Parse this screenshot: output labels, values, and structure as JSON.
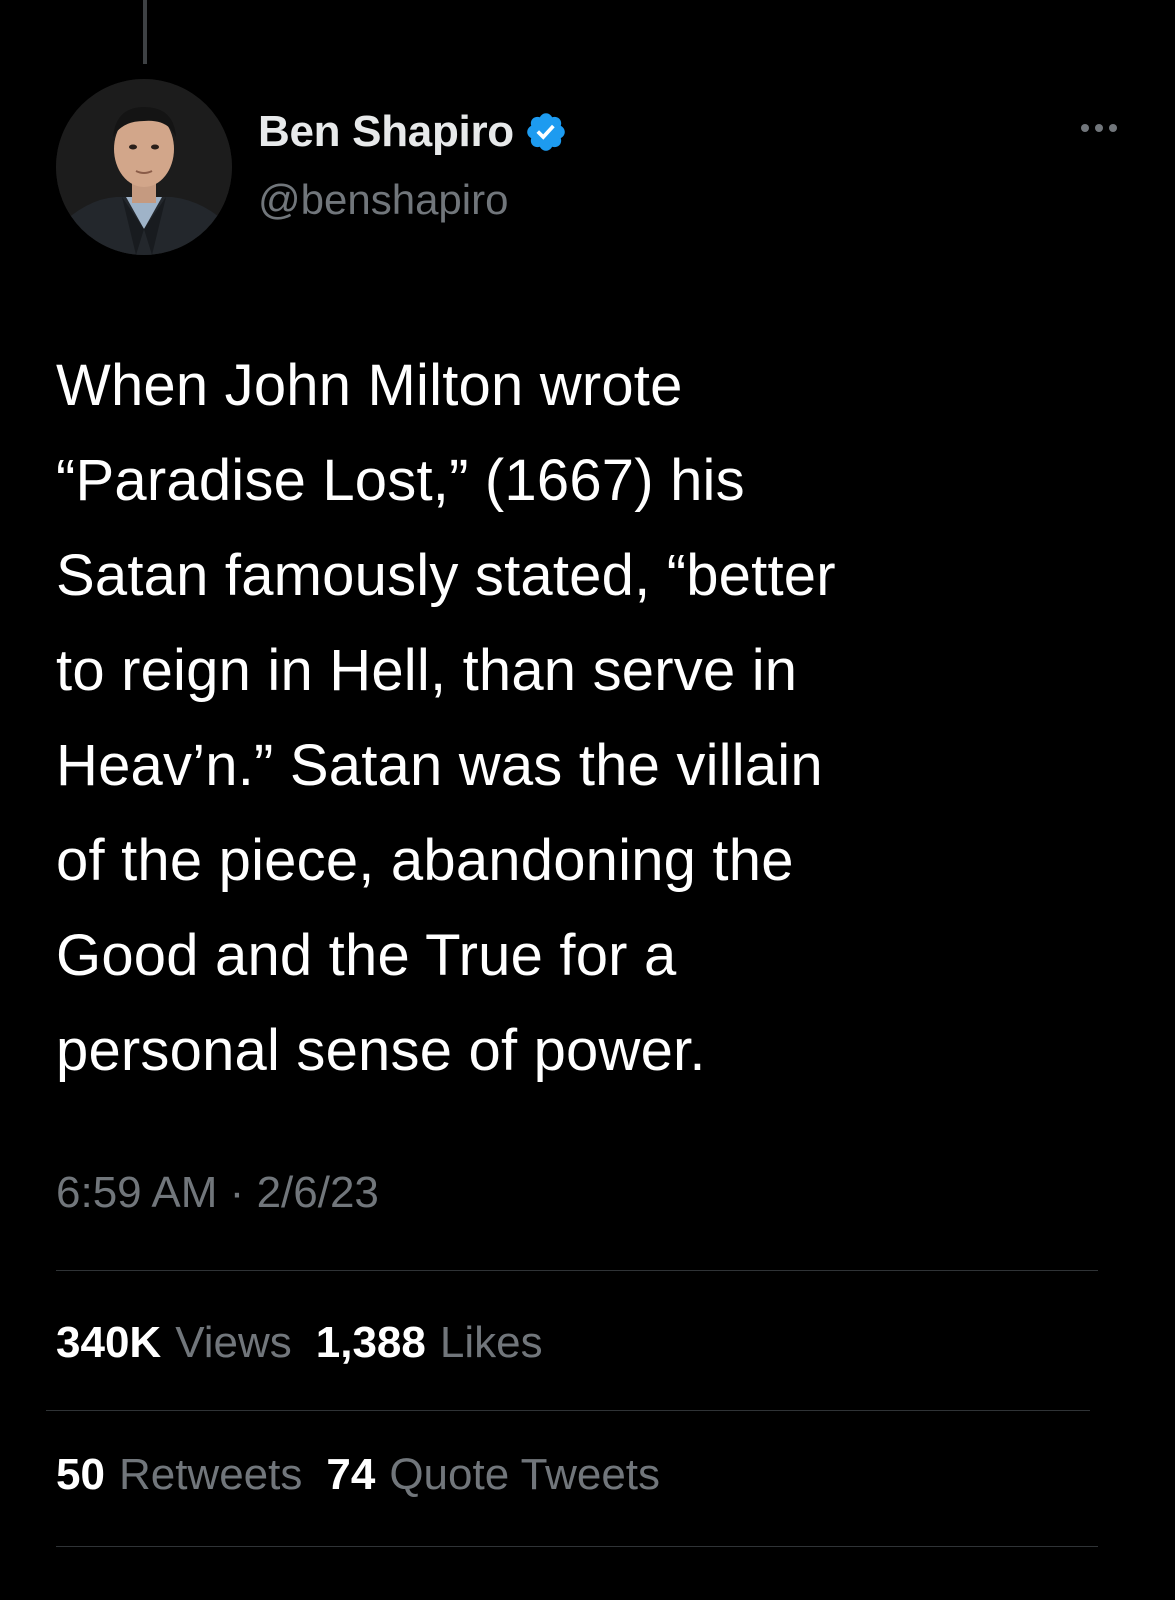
{
  "author": {
    "display_name": "Ben Shapiro",
    "handle": "@benshapiro",
    "verified": true,
    "verified_color": "#1d9bf0"
  },
  "tweet": {
    "text_lines": [
      "When John Milton wrote",
      "“Paradise Lost,” (1667) his",
      "Satan famously stated, “better",
      "to reign in Hell, than serve in",
      "Heav’n.” Satan was the villain",
      "of the piece, abandoning the",
      "Good and the True for a",
      "personal sense of power."
    ],
    "time": "6:59 AM",
    "separator": "·",
    "date": "2/6/23"
  },
  "stats": {
    "views": {
      "count": "340K",
      "label": "Views"
    },
    "likes": {
      "count": "1,388",
      "label": "Likes"
    },
    "retweets": {
      "count": "50",
      "label": "Retweets"
    },
    "quotes": {
      "count": "74",
      "label": "Quote Tweets"
    }
  },
  "icons": {
    "more": "more-horizontal-icon",
    "verified": "verified-badge-icon"
  },
  "colors": {
    "background": "#000000",
    "primary_text": "#e7e9ea",
    "secondary_text": "#71767b",
    "divider": "#2f3336",
    "accent": "#1d9bf0"
  }
}
